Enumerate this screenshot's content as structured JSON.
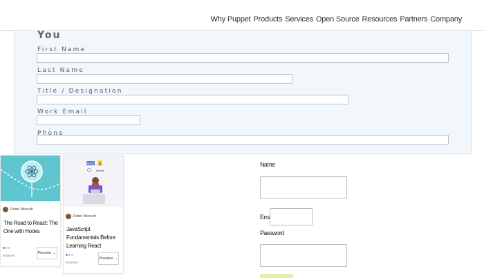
{
  "nav": {
    "items": [
      "Why Puppet",
      "Products",
      "Services",
      "Open Source",
      "Resources",
      "Partners",
      "Company"
    ]
  },
  "form": {
    "title": "You",
    "first_name_label": "First Name",
    "last_name_label": "Last Name",
    "title_label": "Title / Designation",
    "work_email_label": "Work Email",
    "phone_label": "Phone"
  },
  "courses": [
    {
      "author": "Robin Wieruch",
      "title": "The Road to React: The One with Hooks",
      "level": "Beginner",
      "preview_label": "Preview"
    },
    {
      "author": "Robin Wieruch",
      "title": "JavaScript Fundamentals Before Learning React",
      "level": "Beginner",
      "preview_label": "Preview",
      "logo_react": "REACT",
      "logo_js": "JS",
      "logo_esnext": "esnext"
    }
  ],
  "login": {
    "name_label": "Name",
    "email_label": "Email",
    "password_label": "Password"
  },
  "colors": {
    "panel_bg": "#f2f7fc",
    "card1_bg": "#5fc6cf",
    "accent": "#7b7fcf"
  }
}
